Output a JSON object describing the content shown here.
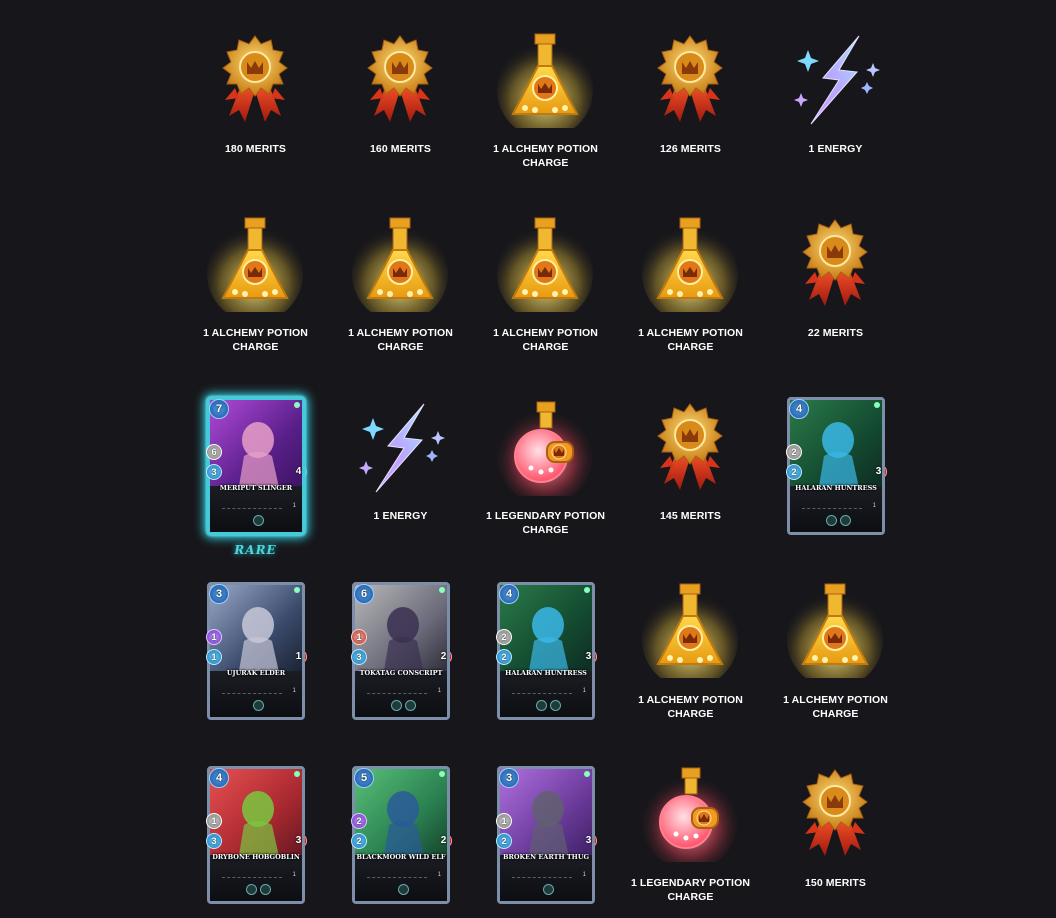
{
  "colors": {
    "background": "#17161a",
    "merit_gold": "#e0a030",
    "merit_ribbon": "#c0301a",
    "energy": "#9ba8ff",
    "alchemy": "#f3c030",
    "legendary": "#ff7080",
    "rare": "#35d6e8"
  },
  "rewards": [
    {
      "kind": "merits",
      "label": "180 MERITS",
      "icon": "merits-medal-icon"
    },
    {
      "kind": "merits",
      "label": "160 MERITS",
      "icon": "merits-medal-icon"
    },
    {
      "kind": "alchemy",
      "label": "1 ALCHEMY POTION CHARGE",
      "icon": "alchemy-potion-icon"
    },
    {
      "kind": "merits",
      "label": "126 MERITS",
      "icon": "merits-medal-icon"
    },
    {
      "kind": "energy",
      "label": "1 ENERGY",
      "icon": "energy-bolt-icon"
    },
    {
      "kind": "alchemy",
      "label": "1 ALCHEMY POTION CHARGE",
      "icon": "alchemy-potion-icon"
    },
    {
      "kind": "alchemy",
      "label": "1 ALCHEMY POTION CHARGE",
      "icon": "alchemy-potion-icon"
    },
    {
      "kind": "alchemy",
      "label": "1 ALCHEMY POTION CHARGE",
      "icon": "alchemy-potion-icon"
    },
    {
      "kind": "alchemy",
      "label": "1 ALCHEMY POTION CHARGE",
      "icon": "alchemy-potion-icon"
    },
    {
      "kind": "merits",
      "label": "22 MERITS",
      "icon": "merits-medal-icon"
    },
    {
      "kind": "card",
      "name": "MERIPUT SLINGER",
      "mana": "7",
      "attack": "6",
      "attack_type": "melee",
      "speed": "3",
      "health": "4",
      "level": "1",
      "rarity": "RARE",
      "element": "death",
      "abilities": 1
    },
    {
      "kind": "energy",
      "label": "1 ENERGY",
      "icon": "energy-bolt-icon"
    },
    {
      "kind": "legendary",
      "label": "1 LEGENDARY POTION CHARGE",
      "icon": "legendary-potion-icon"
    },
    {
      "kind": "merits",
      "label": "145 MERITS",
      "icon": "merits-medal-icon"
    },
    {
      "kind": "card",
      "name": "HALARAN HUNTRESS",
      "mana": "4",
      "attack": "2",
      "attack_type": "melee",
      "speed": "2",
      "health": "3",
      "level": "1",
      "element": "earth",
      "abilities": 2
    },
    {
      "kind": "card",
      "name": "UJURAK ELDER",
      "mana": "3",
      "attack": "1",
      "attack_type": "magic",
      "speed": "1",
      "health": "1",
      "level": "1",
      "element": "earth",
      "abilities": 1
    },
    {
      "kind": "card",
      "name": "TOKATAG CONSCRIPT",
      "mana": "6",
      "attack": "1",
      "attack_type": "ranged",
      "speed": "3",
      "health": "2",
      "level": "1",
      "element": "earth",
      "abilities": 2
    },
    {
      "kind": "card",
      "name": "HALARAN HUNTRESS",
      "mana": "4",
      "attack": "2",
      "attack_type": "melee",
      "speed": "2",
      "health": "3",
      "level": "1",
      "element": "earth",
      "abilities": 2
    },
    {
      "kind": "alchemy",
      "label": "1 ALCHEMY POTION CHARGE",
      "icon": "alchemy-potion-icon"
    },
    {
      "kind": "alchemy",
      "label": "1 ALCHEMY POTION CHARGE",
      "icon": "alchemy-potion-icon"
    },
    {
      "kind": "card",
      "name": "DRYBONE HOBGOBLIN",
      "mana": "4",
      "attack": "1",
      "attack_type": "melee",
      "speed": "3",
      "health": "3",
      "level": "1",
      "element": "earth",
      "abilities": 2
    },
    {
      "kind": "card",
      "name": "BLACKMOOR WILD ELF",
      "mana": "5",
      "attack": "2",
      "attack_type": "magic",
      "speed": "2",
      "health": "2",
      "level": "1",
      "element": "earth",
      "abilities": 1
    },
    {
      "kind": "card",
      "name": "BROKEN EARTH THUG",
      "mana": "3",
      "attack": "1",
      "attack_type": "melee",
      "speed": "2",
      "health": "3",
      "level": "1",
      "element": "earth",
      "abilities": 1
    },
    {
      "kind": "legendary",
      "label": "1 LEGENDARY POTION CHARGE",
      "icon": "legendary-potion-icon"
    },
    {
      "kind": "merits",
      "label": "150 MERITS",
      "icon": "merits-medal-icon"
    }
  ]
}
